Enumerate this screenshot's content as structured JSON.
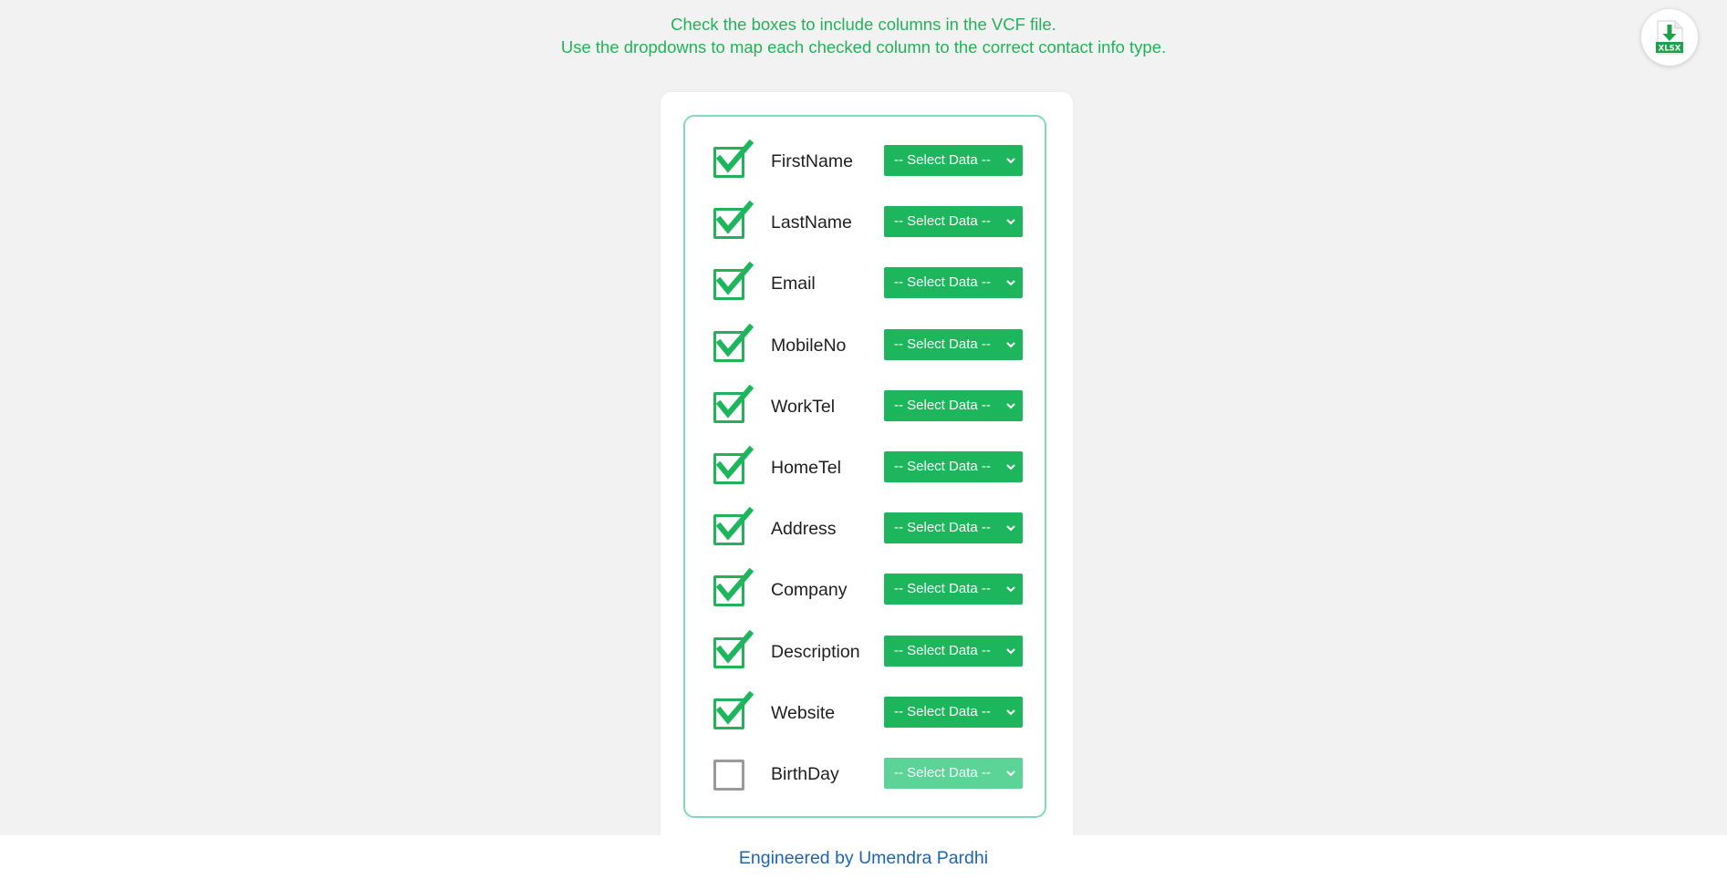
{
  "instructions": {
    "line1": "Check the boxes to include columns in the VCF file.",
    "line2": "Use the dropdowns to map each checked column to the correct contact info type."
  },
  "download": {
    "icon": "download-xlsx-icon",
    "badge": "XLSX"
  },
  "columns": [
    {
      "label": "FirstName",
      "checked": true,
      "select": "-- Select Data --"
    },
    {
      "label": "LastName",
      "checked": true,
      "select": "-- Select Data --"
    },
    {
      "label": "Email",
      "checked": true,
      "select": "-- Select Data --"
    },
    {
      "label": "MobileNo",
      "checked": true,
      "select": "-- Select Data --"
    },
    {
      "label": "WorkTel",
      "checked": true,
      "select": "-- Select Data --"
    },
    {
      "label": "HomeTel",
      "checked": true,
      "select": "-- Select Data --"
    },
    {
      "label": "Address",
      "checked": true,
      "select": "-- Select Data --"
    },
    {
      "label": "Company",
      "checked": true,
      "select": "-- Select Data --"
    },
    {
      "label": "Description",
      "checked": true,
      "select": "-- Select Data --"
    },
    {
      "label": "Website",
      "checked": true,
      "select": "-- Select Data --"
    },
    {
      "label": "BirthDay",
      "checked": false,
      "select": "-- Select Data --"
    }
  ],
  "footer": {
    "credit": "Engineered by Umendra Pardhi"
  },
  "colors": {
    "accent": "#1db65c",
    "instruction_text": "#22b35a",
    "disabled_select": "#5dd497",
    "panel_border": "#7fdcb7",
    "credit_text": "#1e64b4",
    "background": "#f2f2f2"
  }
}
